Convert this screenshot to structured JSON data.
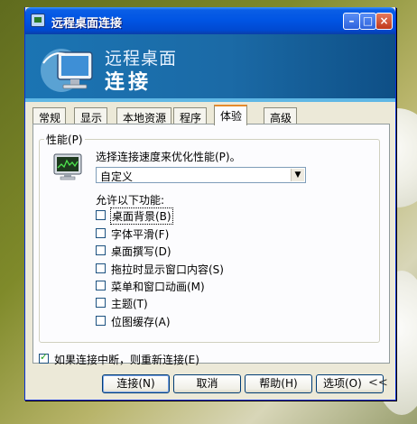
{
  "window": {
    "title": "远程桌面连接",
    "controls": {
      "minimize": "–",
      "maximize": "□",
      "close": "×"
    }
  },
  "banner": {
    "title_line1": "远程桌面",
    "title_line2": "连接"
  },
  "tabs": [
    {
      "label": "常规"
    },
    {
      "label": "显示"
    },
    {
      "label": "本地资源"
    },
    {
      "label": "程序"
    },
    {
      "label": "体验",
      "active": true
    },
    {
      "label": "高级"
    }
  ],
  "performance": {
    "group_label": "性能(P)",
    "speed_label": "选择连接速度来优化性能(P)。",
    "speed_value": "自定义",
    "allow_label": "允许以下功能:",
    "options": [
      {
        "label": "桌面背景(B)",
        "checked": false
      },
      {
        "label": "字体平滑(F)",
        "checked": false
      },
      {
        "label": "桌面撰写(D)",
        "checked": false
      },
      {
        "label": "拖拉时显示窗口内容(S)",
        "checked": false
      },
      {
        "label": "菜单和窗口动画(M)",
        "checked": false
      },
      {
        "label": "主题(T)",
        "checked": false
      },
      {
        "label": "位图缓存(A)",
        "checked": false
      }
    ]
  },
  "reconnect": {
    "label": "如果连接中断，则重新连接(E)",
    "checked": true
  },
  "buttons": {
    "connect": "连接(N)",
    "cancel": "取消",
    "help": "帮助(H)",
    "options": "选项(O)",
    "collapse": "<<"
  },
  "icons": {
    "app": "remote-desktop-icon",
    "banner": "remote-desktop-monitor-icon",
    "performance": "performance-monitor-icon"
  }
}
